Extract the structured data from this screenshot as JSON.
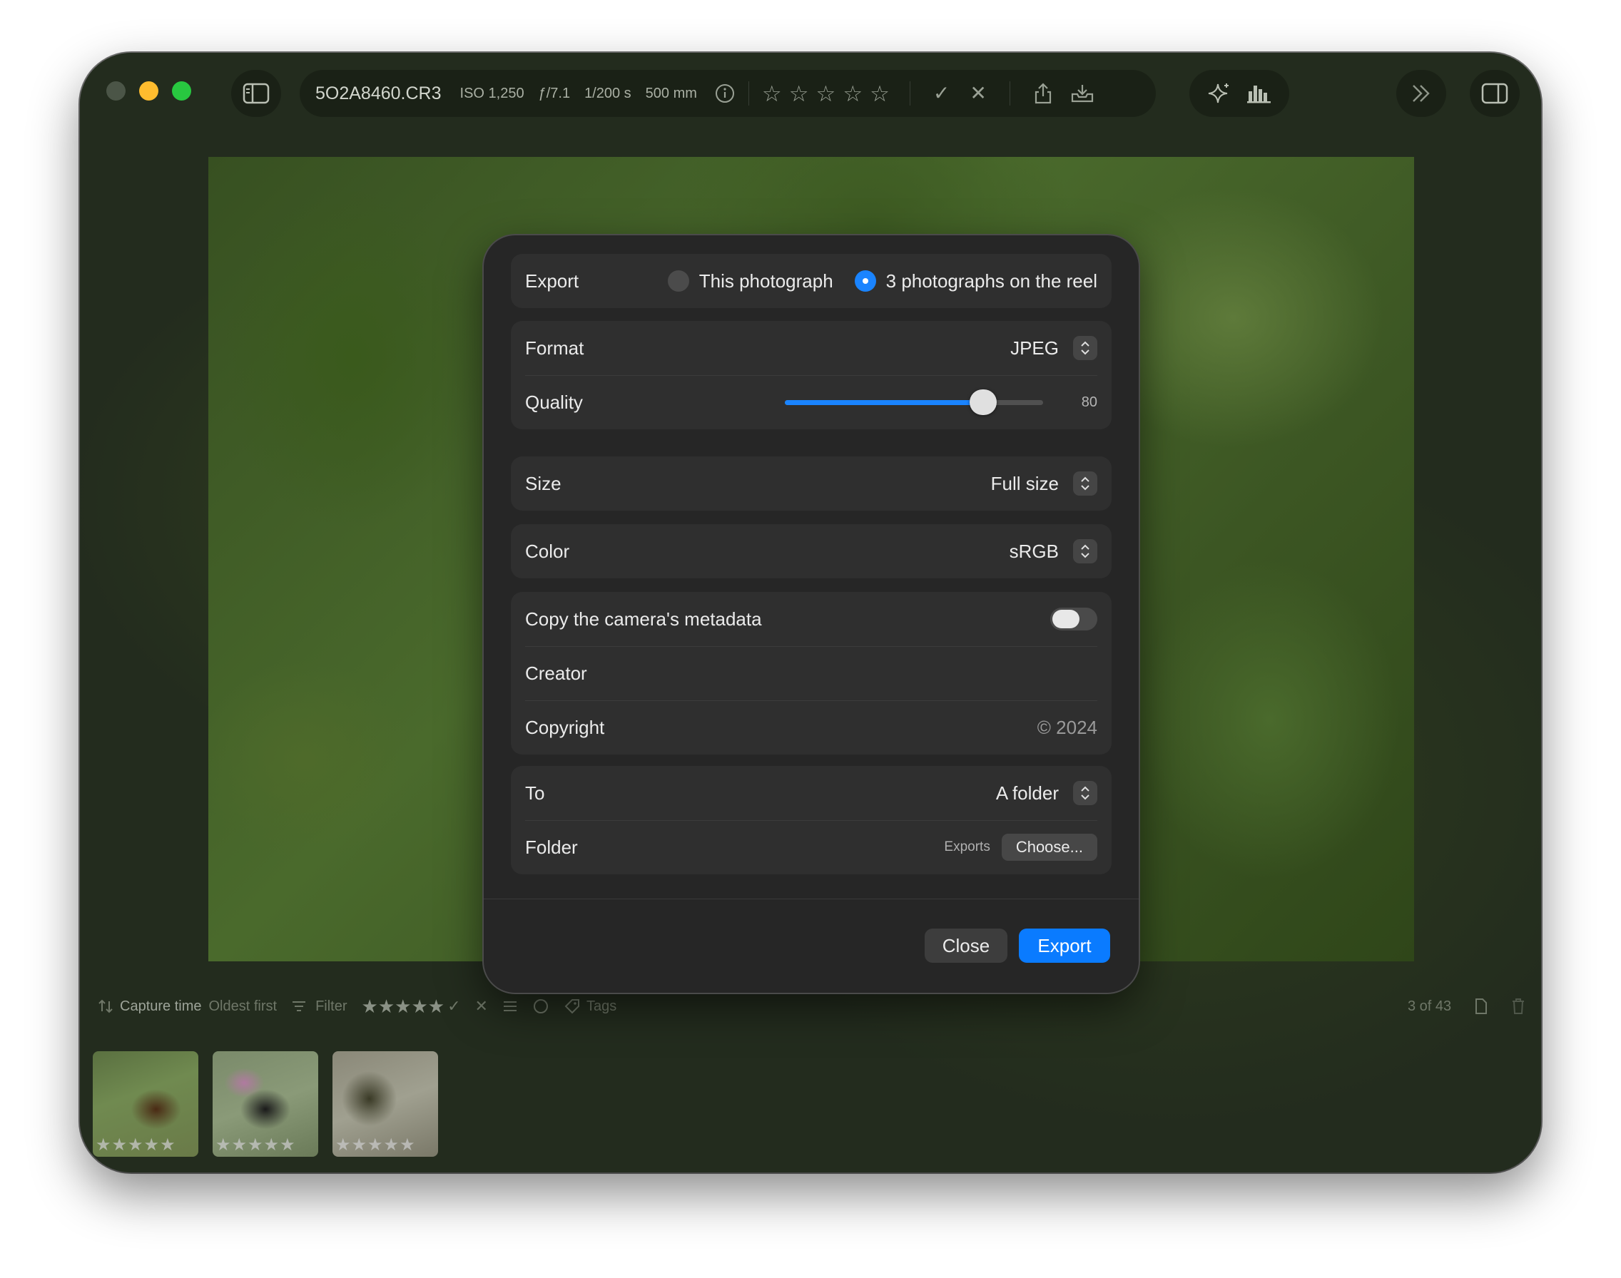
{
  "toolbar": {
    "filename": "5O2A8460.CR3",
    "iso": "ISO 1,250",
    "aperture": "ƒ/7.1",
    "shutter": "1/200 s",
    "focal_length": "500 mm",
    "rating_stars": [
      "☆",
      "☆",
      "☆",
      "☆",
      "☆"
    ],
    "pick_glyph": "✓",
    "reject_glyph": "✕"
  },
  "dialog": {
    "export_label": "Export",
    "option_this": "This photograph",
    "option_reel": "3 photographs on the reel",
    "selected_option": "3 photographs on the reel",
    "format_label": "Format",
    "format_value": "JPEG",
    "quality_label": "Quality",
    "quality_value": "80",
    "quality_level": 0.8,
    "size_label": "Size",
    "size_value": "Full size",
    "color_label": "Color",
    "color_value": "sRGB",
    "metadata_label": "Copy the camera's metadata",
    "metadata_on": false,
    "creator_label": "Creator",
    "creator_value": "",
    "copyright_label": "Copyright",
    "copyright_value": "© 2024",
    "to_label": "To",
    "to_value": "A folder",
    "folder_label": "Folder",
    "folder_value": "Exports",
    "choose_label": "Choose...",
    "close_label": "Close",
    "export_button_label": "Export",
    "accent_color": "#0a7bff"
  },
  "bottombar": {
    "sort_label": "Capture time",
    "sort_order": "Oldest first",
    "filter_label": "Filter",
    "filter_stars": "★★★★★",
    "tags_label": "Tags",
    "count": "3 of 43"
  },
  "filmstrip": [
    {
      "stars": "★★★★★"
    },
    {
      "stars": "★★★★★"
    },
    {
      "stars": "★★★★★"
    }
  ]
}
